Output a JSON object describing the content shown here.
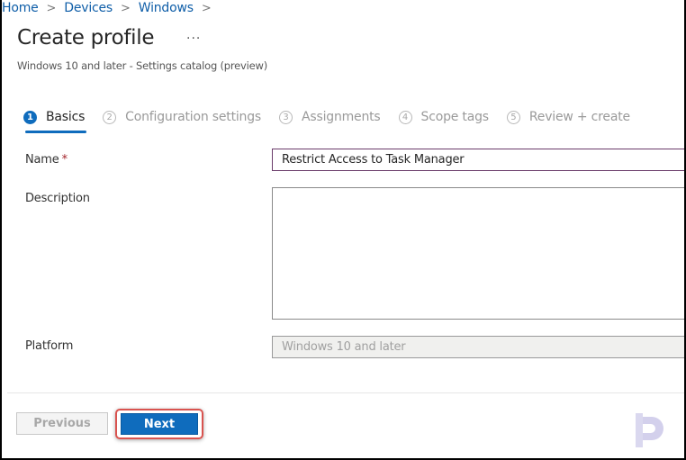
{
  "breadcrumb": {
    "items": [
      "Home",
      "Devices",
      "Windows"
    ],
    "separator_icon": "chevron-right-icon"
  },
  "header": {
    "title": "Create profile",
    "more_label": "···",
    "subtitle": "Windows 10 and later - Settings catalog (preview)"
  },
  "steps": [
    {
      "number": "1",
      "label": "Basics",
      "active": true
    },
    {
      "number": "2",
      "label": "Configuration settings",
      "active": false
    },
    {
      "number": "3",
      "label": "Assignments",
      "active": false
    },
    {
      "number": "4",
      "label": "Scope tags",
      "active": false
    },
    {
      "number": "5",
      "label": "Review + create",
      "active": false
    }
  ],
  "form": {
    "name": {
      "label": "Name",
      "required_mark": "*",
      "value": "Restrict Access to Task Manager"
    },
    "description": {
      "label": "Description",
      "value": ""
    },
    "platform": {
      "label": "Platform",
      "value": "Windows 10 and later"
    }
  },
  "footer": {
    "previous_label": "Previous",
    "next_label": "Next"
  },
  "colors": {
    "accent": "#0f6cbd",
    "highlight": "#d9534f",
    "required": "#a4262c"
  }
}
